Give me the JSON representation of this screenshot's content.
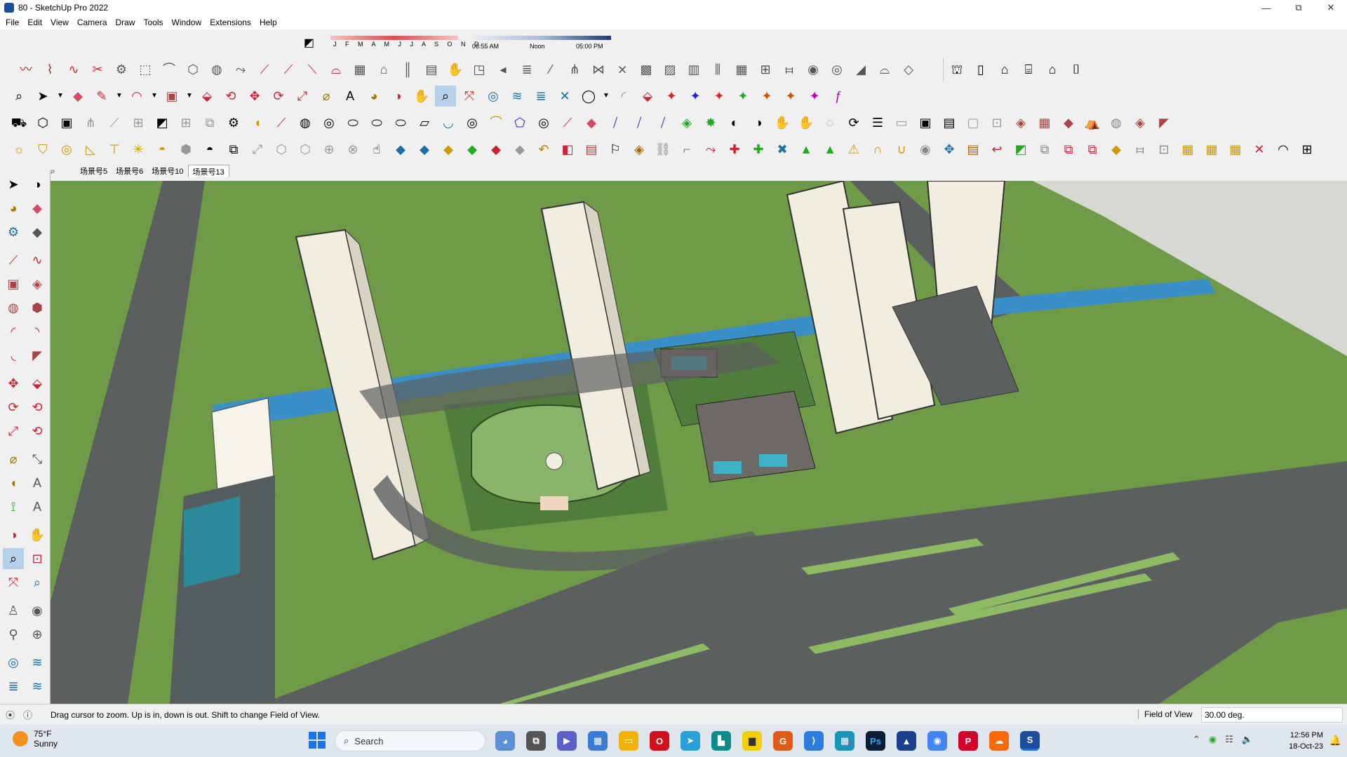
{
  "window": {
    "title": "80 - SketchUp Pro 2022",
    "minimize": "—",
    "maximize": "⧉",
    "close": "✕"
  },
  "menu": [
    "File",
    "Edit",
    "View",
    "Camera",
    "Draw",
    "Tools",
    "Window",
    "Extensions",
    "Help"
  ],
  "shadows": {
    "months": "J F M A M J J A S O N D",
    "time_start": "06:55 AM",
    "time_mid": "Noon",
    "time_end": "05:00 PM"
  },
  "scenes": {
    "tabs": [
      "场景号5",
      "场景号6",
      "场景号10",
      "场景号13"
    ],
    "active_index": 3
  },
  "status": {
    "hint": "Drag cursor to zoom.  Up is in, down is out. Shift to change Field of View.",
    "measurement_label": "Field of View",
    "measurement_value": "30.00 deg."
  },
  "taskbar": {
    "weather_temp": "75°F",
    "weather_cond": "Sunny",
    "search_label": "Search",
    "time": "12:56 PM",
    "date": "18-Oct-23"
  },
  "colors": {
    "ground": "#6f9a47",
    "road": "#5c5f60",
    "water": "#3b8fc9",
    "tower": "#f1eee0",
    "lawn": "#89b46a"
  }
}
